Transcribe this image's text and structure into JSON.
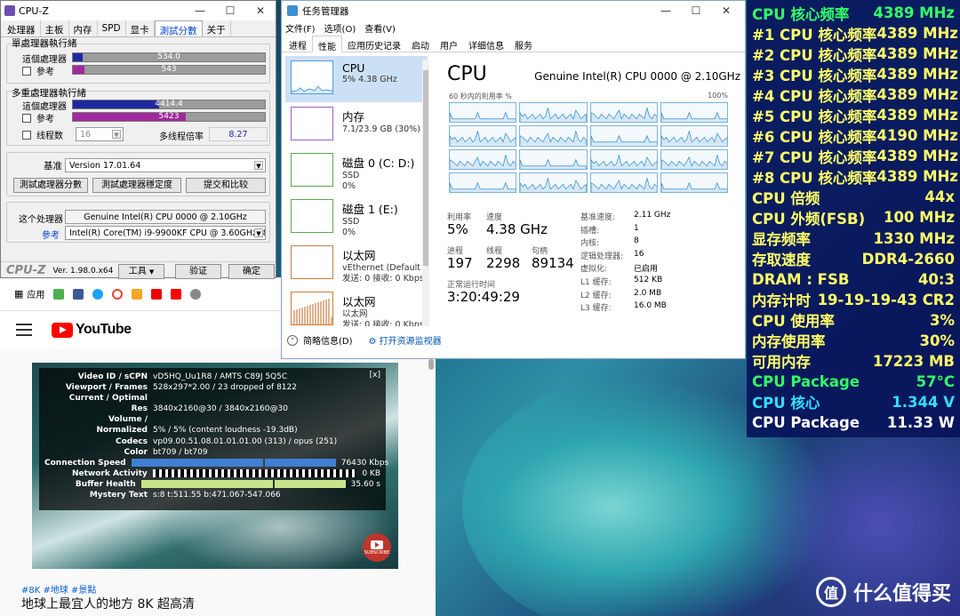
{
  "colors": {
    "osd_bg": "#08145a",
    "osd_yellow": "#ffff66",
    "osd_green": "#33ff66",
    "osd_cyan": "#33ddff",
    "osd_white": "#ffffff",
    "bench_this": "#1e2a9e",
    "bench_ref": "#a02a9e"
  },
  "cpuz": {
    "title": "CPU-Z",
    "tabs": [
      "处理器",
      "主板",
      "内存",
      "SPD",
      "显卡",
      "測試分數",
      "关于"
    ],
    "active_tab": 5,
    "single_group": "單處理器執行緒",
    "multi_group": "多重處理器執行緒",
    "this_cpu": "這個處理器",
    "reference": "參考",
    "threads_label": "线程数",
    "threads_value": "16",
    "multi_ratio_label": "多线程倍率",
    "multi_ratio": "8.27",
    "single_this": "534.0",
    "single_ref": "543",
    "multi_this": "4414.4",
    "multi_ref": "5423",
    "single_this_frac": 0.05,
    "single_ref_frac": 0.06,
    "multi_this_frac": 0.45,
    "multi_ref_frac": 0.59,
    "benchmark_label": "基准",
    "benchmark_version": "Version 17.01.64",
    "btn_bench": "測試處理器分數",
    "btn_stress": "測試處理器穩定度",
    "btn_submit": "提交和比较",
    "this_processor_label": "这个处理器",
    "this_processor": "Genuine Intel(R) CPU 0000 @ 2.10GHz",
    "ref_label": "參考",
    "ref_processor": "Intel(R) Core(TM) i9-9900KF CPU @ 3.60GHz (8C/16T)",
    "logo": "CPU-Z",
    "version": "Ver. 1.98.0.x64",
    "btn_tools": "工具",
    "btn_validate": "验证",
    "btn_ok": "确定"
  },
  "taskmgr": {
    "title": "任务管理器",
    "menu": [
      "文件(F)",
      "选项(O)",
      "查看(V)"
    ],
    "tabs": [
      "进程",
      "性能",
      "应用历史记录",
      "启动",
      "用户",
      "详细信息",
      "服务"
    ],
    "active_tab": 1,
    "side": [
      {
        "name": "CPU",
        "sub1": "5% 4.38 GHz",
        "sub2": "",
        "sub3": ""
      },
      {
        "name": "内存",
        "sub1": "7.1/23.9 GB (30%)",
        "sub2": "",
        "sub3": ""
      },
      {
        "name": "磁盘 0 (C: D:)",
        "sub1": "SSD",
        "sub2": "0%",
        "sub3": ""
      },
      {
        "name": "磁盘 1 (E:)",
        "sub1": "SSD",
        "sub2": "0%",
        "sub3": ""
      },
      {
        "name": "以太网",
        "sub1": "vEthernet (Default",
        "sub2": "发送: 0 接收: 0 Kbps",
        "sub3": ""
      },
      {
        "name": "以太网",
        "sub1": "以太网",
        "sub2": "发送: 0 接收: 0 Kbps",
        "sub3": ""
      }
    ],
    "cpu_title": "CPU",
    "cpu_model": "Genuine Intel(R) CPU 0000 @ 2.10GHz",
    "graph_label": "60 秒内的利用率 %",
    "graph_max": "100%",
    "util_label": "利用率",
    "util": "5%",
    "speed_label": "速度",
    "speed": "4.38 GHz",
    "proc_label": "进程",
    "procs": "197",
    "threads_label": "线程",
    "threads": "2298",
    "handles_label": "句柄",
    "handles": "89134",
    "uptime_label": "正常运行时间",
    "uptime": "3:20:49:29",
    "specs": [
      {
        "k": "基准速度:",
        "v": "2.11 GHz"
      },
      {
        "k": "插槽:",
        "v": "1"
      },
      {
        "k": "内核:",
        "v": "8"
      },
      {
        "k": "逻辑处理器:",
        "v": "16"
      },
      {
        "k": "虚拟化:",
        "v": "已启用"
      },
      {
        "k": "L1 缓存:",
        "v": "512 KB"
      },
      {
        "k": "L2 缓存:",
        "v": "2.0 MB"
      },
      {
        "k": "L3 缓存:",
        "v": "16.0 MB"
      }
    ],
    "brief": "简略信息(D)",
    "resmon": "打开资源监视器"
  },
  "browser": {
    "apps_label": "应用",
    "yt_word": "YouTube",
    "tags": "#8K #地球 #景點",
    "video_title": "地球上最宜人的地方 8K 超高清",
    "subscribe": "SUBSCRIBE",
    "stats_close": "[x]",
    "stats": [
      {
        "k": "Video ID / sCPN",
        "v": "vD5HQ_Uu1R8 / AMTS C89J 5Q5C"
      },
      {
        "k": "Viewport / Frames",
        "v": "528x297*2.00 / 23 dropped of 8122"
      },
      {
        "k": "Current / Optimal",
        "v": ""
      },
      {
        "k": "Res",
        "v": "3840x2160@30 / 3840x2160@30"
      },
      {
        "k": "Volume /",
        "v": ""
      },
      {
        "k": "Normalized",
        "v": "5% / 5% (content loudness -19.3dB)"
      },
      {
        "k": "Codecs",
        "v": "vp09.00.51.08.01.01.01.00 (313) / opus (251)"
      },
      {
        "k": "Color",
        "v": "bt709 / bt709"
      }
    ],
    "conn_label": "Connection Speed",
    "conn_value": "76430 Kbps",
    "net_label": "Network Activity",
    "net_value": "0 KB",
    "buf_label": "Buffer Health",
    "buf_value": "35.60 s",
    "mystery_label": "Mystery Text",
    "mystery_value": "s:8 t:511.55 b:471.067-547.066"
  },
  "osd": [
    {
      "label": "CPU 核心频率",
      "value": "4389 MHz",
      "color": "#33ff66"
    },
    {
      "label": "#1 CPU 核心频率",
      "value": "4389 MHz",
      "color": "#ffff66"
    },
    {
      "label": "#2 CPU 核心频率",
      "value": "4389 MHz",
      "color": "#ffff66"
    },
    {
      "label": "#3 CPU 核心频率",
      "value": "4389 MHz",
      "color": "#ffff66"
    },
    {
      "label": "#4 CPU 核心频率",
      "value": "4389 MHz",
      "color": "#ffff66"
    },
    {
      "label": "#5 CPU 核心频率",
      "value": "4389 MHz",
      "color": "#ffff66"
    },
    {
      "label": "#6 CPU 核心频率",
      "value": "4190 MHz",
      "color": "#ffff66"
    },
    {
      "label": "#7 CPU 核心频率",
      "value": "4389 MHz",
      "color": "#ffff66"
    },
    {
      "label": "#8 CPU 核心频率",
      "value": "4389 MHz",
      "color": "#ffff66"
    },
    {
      "label": "CPU 倍频",
      "value": "44x",
      "color": "#ffff66"
    },
    {
      "label": "CPU 外频(FSB)",
      "value": "100 MHz",
      "color": "#ffff66"
    },
    {
      "label": "显存频率",
      "value": "1330 MHz",
      "color": "#ffff66"
    },
    {
      "label": "存取速度",
      "value": "DDR4-2660",
      "color": "#ffff66"
    },
    {
      "label": "DRAM : FSB",
      "value": "40:3",
      "color": "#ffff66"
    },
    {
      "label": "内存计时",
      "value": "19-19-19-43 CR2",
      "color": "#ffff66"
    },
    {
      "label": "CPU 使用率",
      "value": "3%",
      "color": "#ffff66"
    },
    {
      "label": "内存使用率",
      "value": "30%",
      "color": "#ffff66"
    },
    {
      "label": "可用内存",
      "value": "17223 MB",
      "color": "#ffff66"
    },
    {
      "label": "CPU Package",
      "value": "57°C",
      "color": "#33ff66"
    },
    {
      "label": "CPU 核心",
      "value": "1.344 V",
      "color": "#33ddff"
    },
    {
      "label": "CPU Package",
      "value": "11.33 W",
      "color": "#ffffff"
    }
  ],
  "watermark": {
    "logo": "值",
    "text": "什么值得买"
  }
}
